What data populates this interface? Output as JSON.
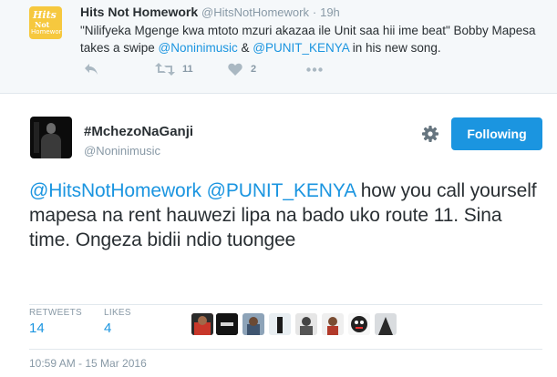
{
  "parent_tweet": {
    "avatar_text": [
      "Hits",
      "Not",
      "Homework"
    ],
    "name": "Hits Not Homework",
    "handle": "@HitsNotHomework",
    "separator": "·",
    "time": "19h",
    "text_before": "\"Nilifyeka Mgenge kwa mtoto mzuri akazaa ile Unit saa hii ime beat\" Bobby Mapesa takes a swipe ",
    "mention_1": "@Noninimusic",
    "text_middle": " & ",
    "mention_2": "@PUNIT_KENYA",
    "text_after": " in his new song.",
    "retweet_count": "11",
    "like_count": "2"
  },
  "main_tweet": {
    "name": "#MchezoNaGanji",
    "handle": "@Noninimusic",
    "follow_label": "Following",
    "mention_1": "@HitsNotHomework",
    "mention_2": "@PUNIT_KENYA",
    "body": " how you call yourself mapesa na rent hauwezi lipa na bado uko route 11. Sina time. Ongeza bidii ndio tuongee",
    "retweets_label": "RETWEETS",
    "retweets_value": "14",
    "likes_label": "LIKES",
    "likes_value": "4",
    "timestamp": "10:59 AM - 15 Mar 2016"
  },
  "icons": {
    "reply": "reply-icon",
    "retweet": "retweet-icon",
    "like": "heart-icon",
    "more": "more-icon",
    "settings": "gear-icon"
  },
  "colors": {
    "link": "#1b95e0",
    "muted": "#8899a6",
    "button": "#1b95e0",
    "parent_bg": "#f5f8fa"
  }
}
